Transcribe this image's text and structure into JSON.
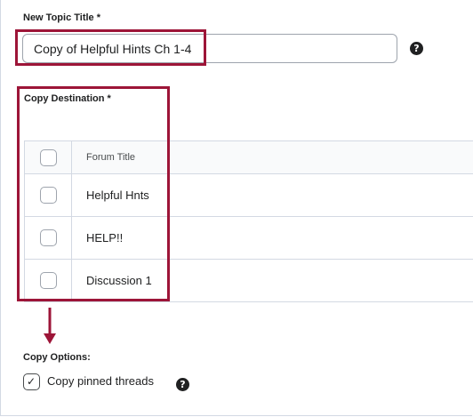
{
  "topic_title": {
    "label": "New Topic Title *",
    "value": "Copy of Helpful Hints Ch 1-4",
    "help_icon": "question-circle-icon"
  },
  "copy_destination": {
    "label": "Copy Destination *",
    "table": {
      "header": "Forum Title",
      "rows": [
        {
          "title": "Helpful Hnts",
          "checked": false
        },
        {
          "title": "HELP!!",
          "checked": false
        },
        {
          "title": "Discussion 1",
          "checked": false
        }
      ]
    }
  },
  "copy_options": {
    "label": "Copy Options:",
    "pinned_threads": {
      "label": "Copy pinned threads",
      "checked": true
    },
    "help_icon": "question-circle-icon"
  },
  "annotation_arrow": "arrow-down-icon",
  "colors": {
    "highlight": "#9d1538",
    "text": "#202122",
    "border": "#d3d9e3",
    "header_bg": "#f9fafb"
  },
  "icons": {
    "help_glyph": "?",
    "check_glyph": "✓"
  }
}
